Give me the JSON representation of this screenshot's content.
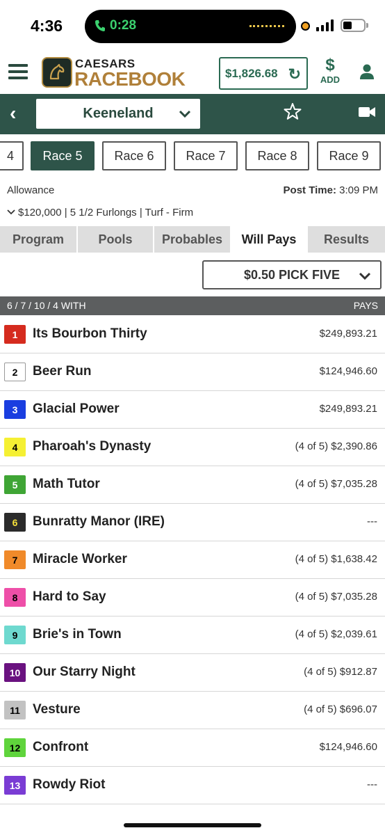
{
  "status": {
    "time": "4:36",
    "call_time": "0:28"
  },
  "brand": {
    "top": "CAESARS",
    "bottom": "RACEBOOK"
  },
  "header": {
    "balance": "$1,826.68",
    "add_symbol": "$",
    "add_label": "ADD"
  },
  "track": {
    "name": "Keeneland"
  },
  "races": [
    {
      "label": "4",
      "active": false
    },
    {
      "label": "Race 5",
      "active": true
    },
    {
      "label": "Race 6",
      "active": false
    },
    {
      "label": "Race 7",
      "active": false
    },
    {
      "label": "Race 8",
      "active": false
    },
    {
      "label": "Race 9",
      "active": false
    }
  ],
  "race_info": {
    "type": "Allowance",
    "post_label": "Post Time:",
    "post_time": "3:09 PM",
    "details": "$120,000 | 5 1/2 Furlongs | Turf - Firm"
  },
  "subtabs": [
    {
      "label": "Program",
      "active": false
    },
    {
      "label": "Pools",
      "active": false
    },
    {
      "label": "Probables",
      "active": false
    },
    {
      "label": "Will Pays",
      "active": true
    },
    {
      "label": "Results",
      "active": false
    }
  ],
  "bet_type": "$0.50 PICK FIVE",
  "combo": {
    "label": "6 / 7 / 10 / 4 WITH",
    "pays_header": "PAYS"
  },
  "runners": [
    {
      "num": "1",
      "name": "Its Bourbon Thirty",
      "pay": "$249,893.21",
      "bg": "#d52b1e",
      "fg": "#ffffff"
    },
    {
      "num": "2",
      "name": "Beer Run",
      "pay": "$124,946.60",
      "bg": "#ffffff",
      "fg": "#000000"
    },
    {
      "num": "3",
      "name": "Glacial Power",
      "pay": "$249,893.21",
      "bg": "#1a3ee0",
      "fg": "#ffffff"
    },
    {
      "num": "4",
      "name": "Pharoah's Dynasty",
      "pay": "(4 of 5) $2,390.86",
      "bg": "#f5f033",
      "fg": "#000000"
    },
    {
      "num": "5",
      "name": "Math Tutor",
      "pay": "(4 of 5) $7,035.28",
      "bg": "#3fa535",
      "fg": "#ffffff"
    },
    {
      "num": "6",
      "name": "Bunratty Manor (IRE)",
      "pay": "---",
      "bg": "#2b2b2b",
      "fg": "#f5e03a"
    },
    {
      "num": "7",
      "name": "Miracle Worker",
      "pay": "(4 of 5) $1,638.42",
      "bg": "#f08a2a",
      "fg": "#000000"
    },
    {
      "num": "8",
      "name": "Hard to Say",
      "pay": "(4 of 5) $7,035.28",
      "bg": "#ee4fa8",
      "fg": "#000000"
    },
    {
      "num": "9",
      "name": "Brie's in Town",
      "pay": "(4 of 5) $2,039.61",
      "bg": "#6ed9cf",
      "fg": "#000000"
    },
    {
      "num": "10",
      "name": "Our Starry Night",
      "pay": "(4 of 5) $912.87",
      "bg": "#6a1280",
      "fg": "#ffffff"
    },
    {
      "num": "11",
      "name": "Vesture",
      "pay": "(4 of 5) $696.07",
      "bg": "#c2c2c2",
      "fg": "#000000"
    },
    {
      "num": "12",
      "name": "Confront",
      "pay": "$124,946.60",
      "bg": "#5fd43c",
      "fg": "#000000"
    },
    {
      "num": "13",
      "name": "Rowdy Riot",
      "pay": "---",
      "bg": "#7a3cd4",
      "fg": "#ffffff"
    }
  ]
}
